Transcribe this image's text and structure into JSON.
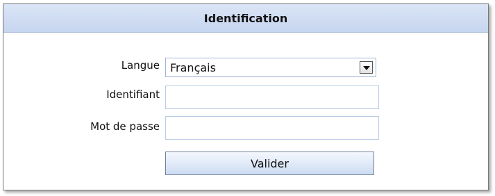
{
  "form": {
    "title": "Identification",
    "language": {
      "label": "Langue",
      "selected": "Français"
    },
    "username": {
      "label": "Identifiant",
      "value": ""
    },
    "password": {
      "label": "Mot de passe",
      "value": ""
    },
    "submit_label": "Valider"
  },
  "icons": {
    "dropdown": "chevron-down-icon"
  }
}
